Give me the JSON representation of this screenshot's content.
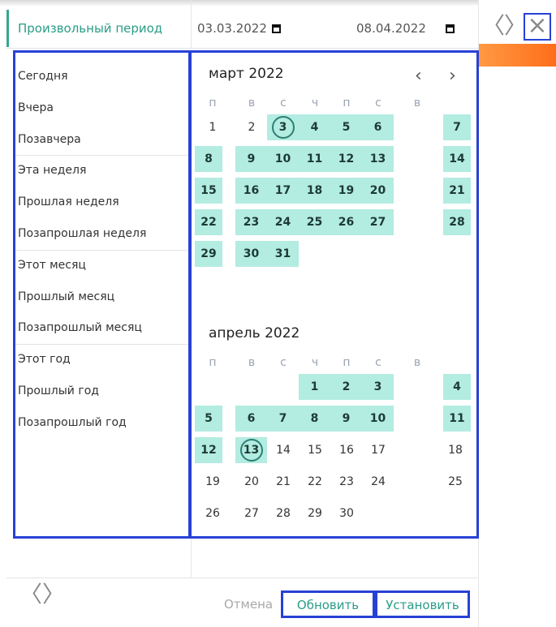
{
  "header": {
    "period_label": "Произвольный период",
    "date_from": "03.03.2022",
    "date_to": "08.04.2022"
  },
  "presets": [
    {
      "label": "Сегодня",
      "group_start": false
    },
    {
      "label": "Вчера",
      "group_start": false
    },
    {
      "label": "Позавчера",
      "group_start": false
    },
    {
      "label": "Эта неделя",
      "group_start": true
    },
    {
      "label": "Прошлая неделя",
      "group_start": false
    },
    {
      "label": "Позапрошлая неделя",
      "group_start": false
    },
    {
      "label": "Этот месяц",
      "group_start": true
    },
    {
      "label": "Прошлый месяц",
      "group_start": false
    },
    {
      "label": "Позапрошлый месяц",
      "group_start": false
    },
    {
      "label": "Этот год",
      "group_start": true
    },
    {
      "label": "Прошлый год",
      "group_start": false
    },
    {
      "label": "Позапрошлый год",
      "group_start": false
    }
  ],
  "weekdays": [
    "п",
    "в",
    "с",
    "ч",
    "п",
    "с",
    "в"
  ],
  "months": [
    {
      "title": "март 2022",
      "first_weekday": 1,
      "days": 31,
      "selected_from": 3,
      "selected_to": 31,
      "circled": [
        3
      ]
    },
    {
      "title": "апрель 2022",
      "first_weekday": 4,
      "days": 30,
      "selected_from": 1,
      "selected_to": 13,
      "circled": [
        13
      ]
    }
  ],
  "footer": {
    "cancel": "Отмена",
    "refresh": "Обновить",
    "apply": "Установить"
  },
  "colors": {
    "accent": "#2a9d88",
    "selection": "#b3ece1",
    "highlight_border": "#2741d6",
    "orange": "#ff7a24"
  },
  "icons": {
    "calendar": "calendar-icon",
    "prev": "chevron-left-icon",
    "next": "chevron-right-icon",
    "close": "close-icon"
  }
}
